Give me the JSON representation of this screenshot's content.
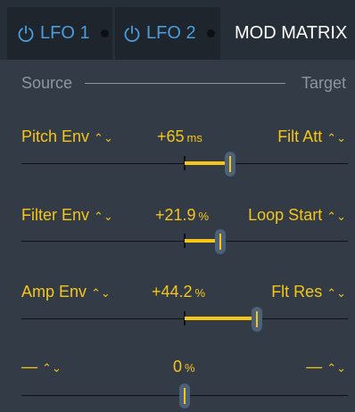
{
  "tabs": {
    "lfo1": {
      "label": "LFO 1"
    },
    "lfo2": {
      "label": "LFO 2"
    },
    "mod_matrix": {
      "label": "MOD MATRIX"
    }
  },
  "header": {
    "source": "Source",
    "target": "Target"
  },
  "rows": [
    {
      "source": "Pitch Env",
      "value": "+65",
      "unit": "ms",
      "target": "Filt Att",
      "amount": 0.14
    },
    {
      "source": "Filter Env",
      "value": "+21.9",
      "unit": "%",
      "target": "Loop Start",
      "amount": 0.11
    },
    {
      "source": "Amp Env",
      "value": "+44.2",
      "unit": "%",
      "target": "Flt Res",
      "amount": 0.22
    },
    {
      "source": "—",
      "value": "0",
      "unit": "%",
      "target": "—",
      "amount": 0.0
    }
  ],
  "colors": {
    "accent": "#f5c518",
    "power": "#4a9ede",
    "panel": "#333c46"
  },
  "icons": {
    "power": "power-icon",
    "chevron": "up-down-chevron-icon"
  }
}
